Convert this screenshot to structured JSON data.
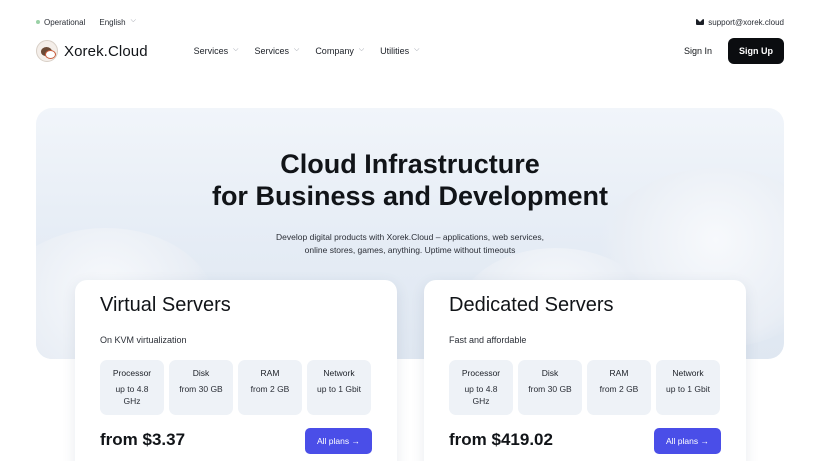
{
  "topbar": {
    "status_label": "Operational",
    "language": "English",
    "support_email": "support@xorek.cloud"
  },
  "nav": {
    "logo_text": "Xorek.Cloud",
    "menu": [
      {
        "label": "Services"
      },
      {
        "label": "Services"
      },
      {
        "label": "Company"
      },
      {
        "label": "Utilities"
      }
    ],
    "sign_in": "Sign In",
    "sign_up": "Sign Up"
  },
  "hero": {
    "title_line1": "Cloud Infrastructure",
    "title_line2": "for Business and Development",
    "subtitle_line1": "Develop digital products with Xorek.Cloud – applications, web services,",
    "subtitle_line2": "online stores, games, anything. Uptime without timeouts"
  },
  "cards": [
    {
      "title": "Virtual Servers",
      "subtitle": "On KVM virtualization",
      "specs": [
        {
          "label": "Processor",
          "value": "up to 4.8 GHz"
        },
        {
          "label": "Disk",
          "value": "from 30 GB"
        },
        {
          "label": "RAM",
          "value": "from 2 GB"
        },
        {
          "label": "Network",
          "value": "up to 1 Gbit"
        }
      ],
      "price": "from $3.37",
      "button": "All plans →"
    },
    {
      "title": "Dedicated Servers",
      "subtitle": "Fast and affordable",
      "specs": [
        {
          "label": "Processor",
          "value": "up to 4.8 GHz"
        },
        {
          "label": "Disk",
          "value": "from 30 GB"
        },
        {
          "label": "RAM",
          "value": "from 2 GB"
        },
        {
          "label": "Network",
          "value": "up to 1 Gbit"
        }
      ],
      "price": "from $419.02",
      "button": "All plans →"
    }
  ]
}
